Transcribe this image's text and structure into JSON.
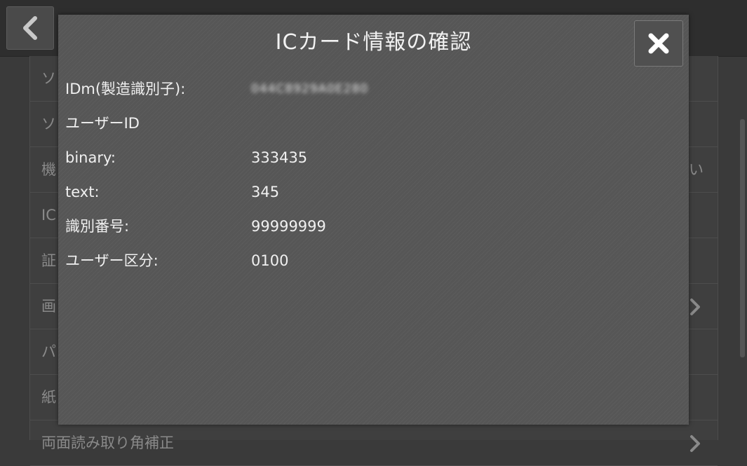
{
  "background": {
    "rows": [
      {
        "label": "ソ",
        "trail": ""
      },
      {
        "label": "ソ",
        "trail": ""
      },
      {
        "label": "機",
        "trail": "い"
      },
      {
        "label": "IC",
        "trail": ""
      },
      {
        "label": "証",
        "trail": ""
      },
      {
        "label": "画",
        "trail": ""
      },
      {
        "label": "パ",
        "trail": ""
      },
      {
        "label": "紙",
        "trail": ""
      },
      {
        "label": "両面読み取り角補正",
        "trail": ""
      }
    ]
  },
  "dialog": {
    "title": "ICカード情報の確認",
    "idm_label": "IDm(製造識別子):",
    "idm_value": "044C8929A0E280",
    "section_label": "ユーザーID",
    "fields": [
      {
        "label": "binary:",
        "value": "333435"
      },
      {
        "label": "text:",
        "value": "345"
      },
      {
        "label": "識別番号:",
        "value": "99999999"
      },
      {
        "label": "ユーザー区分:",
        "value": "0100"
      }
    ]
  },
  "icons": {
    "back": "chevron-left-icon",
    "close": "close-icon",
    "row_chevron": "chevron-right-icon"
  },
  "colors": {
    "dialog_bg": "#565656",
    "text": "#f0f0f0"
  }
}
